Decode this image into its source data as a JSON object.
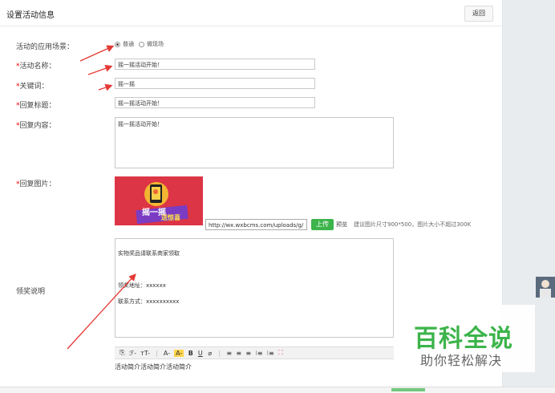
{
  "header": {
    "title": "设置活动信息",
    "back_label": "返回"
  },
  "form": {
    "scene": {
      "label": "活动的应用场景：",
      "options": [
        "普通",
        "微现场"
      ],
      "selected": "普通"
    },
    "name": {
      "required_mark": "*",
      "label": "活动名称：",
      "value": "摇一摇活动开始！"
    },
    "keyword": {
      "required_mark": "*",
      "label": "关键词：",
      "value": "摇一摇"
    },
    "reply_title": {
      "required_mark": "*",
      "label": "回复标题：",
      "value": "摇一摇活动开始！"
    },
    "reply_content": {
      "required_mark": "*",
      "label": "回复内容：",
      "value": "摇一摇活动开始！"
    },
    "reply_image": {
      "required_mark": "*",
      "label": "回复图片：",
      "image_text": [
        "摇一摇",
        "送惊喜"
      ],
      "url": "http://wx.wxbcms.com/uploads/g/",
      "upload_label": "上传",
      "preview_label": "预览",
      "hint": "建议图片尺寸900*500，图片大小不超过300K"
    },
    "prize": {
      "label": "领奖说明",
      "lines": [
        "实物奖品请联系商家领取",
        "",
        "领奖地址：xxxxxx",
        "联系方式：xxxxxxxxxx"
      ]
    },
    "intro": {
      "text": "活动简介活动简介活动简介"
    }
  },
  "toolbar": {
    "items": [
      "⎘",
      "ℱ-",
      "тT-",
      "|",
      "A-",
      "A-",
      "B",
      "U",
      "⌀",
      "|",
      "≡",
      "≡",
      "≡",
      "⁝≡",
      "⁝≡",
      "⛶"
    ],
    "highlight_color": "#ffd54a"
  },
  "watermark": {
    "brand": "百科全说",
    "slogan": "助你轻松解决",
    "color": "#3cb44b"
  },
  "colors": {
    "required": "#ee0000",
    "upload": "#3cb44b",
    "arrow": "#e53935",
    "image_bg": "#dc3545"
  }
}
